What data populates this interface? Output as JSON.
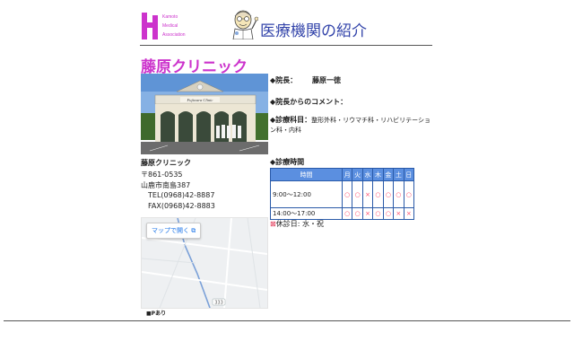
{
  "header": {
    "logo_lines": [
      "Kamoto",
      "Medical",
      "Association"
    ],
    "title": "医療機関の紹介"
  },
  "clinic": {
    "name": "藤原クリニック",
    "photo_sign": "Fujiwara Clinic",
    "info_name": "藤原クリニック",
    "postal": "〒861-0535",
    "address": "山鹿市南島387",
    "tel": "TEL(0968)42-8887",
    "fax": "FAX(0968)42-8883"
  },
  "map": {
    "open_label": "マップで開く",
    "route_badge": "333"
  },
  "parking": "■Pあり",
  "details": {
    "director_label": "◆院長：",
    "director_name": "藤原一徳",
    "comment_label": "◆院長からのコメント：",
    "dept_label": "◆診療科目：",
    "departments": "整形外科・リウマチ科・リハビリテーション科・内科",
    "hours_label": "◆診療時間"
  },
  "schedule": {
    "headers": [
      "時間",
      "月",
      "火",
      "水",
      "木",
      "金",
      "土",
      "日"
    ],
    "rows": [
      {
        "time": "9:00〜12:00",
        "marks": [
          "○",
          "○",
          "×",
          "○",
          "○",
          "○",
          "○"
        ]
      },
      {
        "time": "14:00〜17:00",
        "marks": [
          "○",
          "○",
          "×",
          "○",
          "○",
          "×",
          "×"
        ]
      }
    ]
  },
  "closed": {
    "mark": "⊠",
    "text": "休診日: 水・祝"
  },
  "colors": {
    "accent_magenta": "#cc33cc",
    "title_blue": "#3344aa",
    "table_header": "#5b8fe0",
    "mark_red": "#ff4466"
  }
}
